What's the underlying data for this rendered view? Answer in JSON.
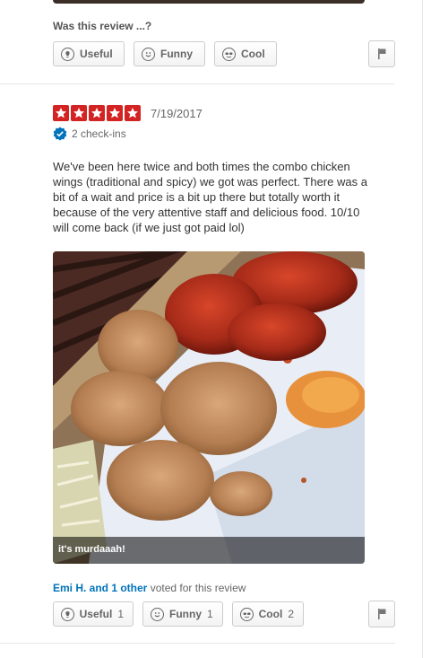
{
  "previous_review": {
    "question": "Was this review ...?",
    "vote_buttons": [
      {
        "label": "Useful",
        "icon": "lightbulb-icon"
      },
      {
        "label": "Funny",
        "icon": "smiley-icon"
      },
      {
        "label": "Cool",
        "icon": "sunglasses-icon"
      }
    ]
  },
  "review": {
    "rating": 5,
    "star_color": "#d32323",
    "date": "7/19/2017",
    "checkins": "2 check-ins",
    "text": "We've been here twice and both times the combo chicken wings (traditional and spicy) we got was perfect. There was a bit of a wait and price is a bit up there but totally worth it because of the very attentive staff and delicious food. 10/10 will come back (if we just got paid lol)",
    "photo": {
      "caption": "it's murdaaah!",
      "description": "plate of fried chicken wings, traditional and spicy"
    },
    "voters": {
      "names": "Emi H. and 1 other",
      "suffix": " voted for this review",
      "link_color": "#0073bb"
    },
    "vote_buttons": [
      {
        "label": "Useful",
        "count": "1",
        "icon": "lightbulb-icon"
      },
      {
        "label": "Funny",
        "count": "1",
        "icon": "smiley-icon"
      },
      {
        "label": "Cool",
        "count": "2",
        "icon": "sunglasses-icon"
      }
    ]
  }
}
